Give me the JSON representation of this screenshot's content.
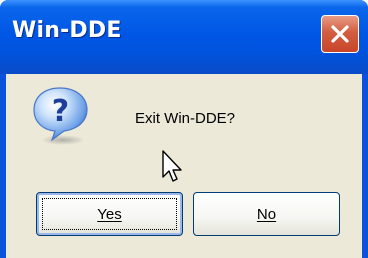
{
  "window": {
    "title": "Win-DDE",
    "close_icon": "close-icon"
  },
  "dialog": {
    "icon": "question-icon",
    "message": "Exit Win-DDE?",
    "buttons": {
      "yes_label": "Yes",
      "no_label": "No"
    },
    "focused_button": "Yes"
  },
  "colors": {
    "titlebar": "#0055e5",
    "client_background": "#ece9d8",
    "close_button": "#d35d41",
    "button_border": "#003c74"
  }
}
